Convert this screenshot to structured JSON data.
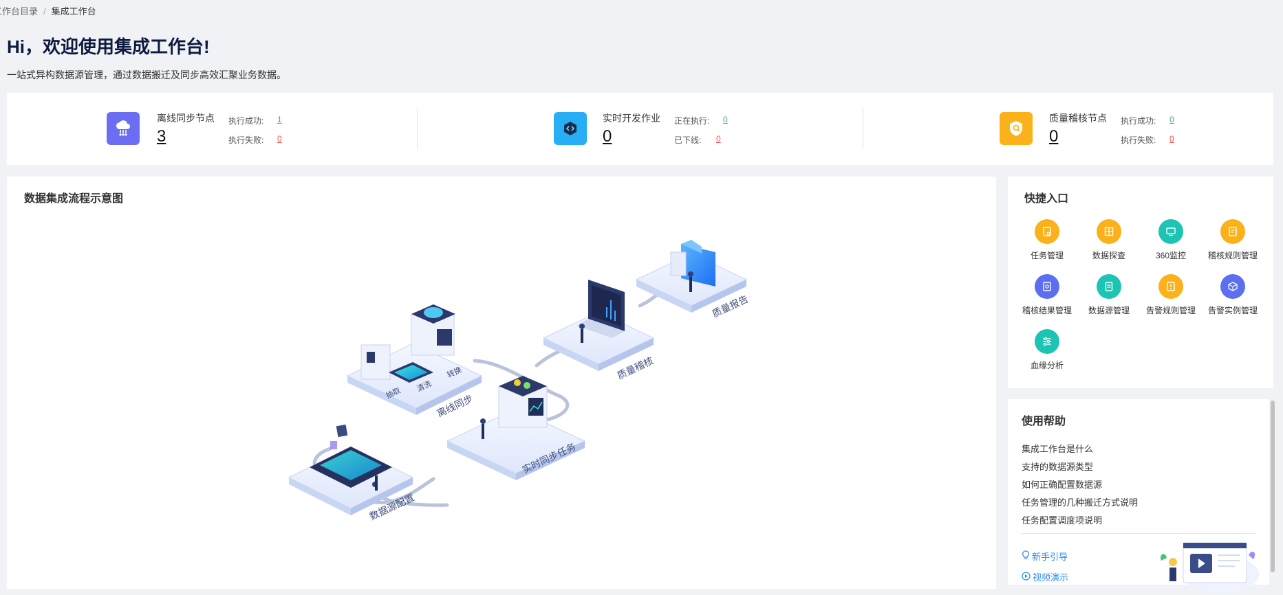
{
  "breadcrumb": {
    "parent": "工作台目录",
    "separator": "/",
    "current": "集成工作台"
  },
  "header": {
    "title": "Hi，欢迎使用集成工作台!",
    "subtitle": "一站式异构数据源管理，通过数据搬迁及同步高效汇聚业务数据。"
  },
  "stats": [
    {
      "name": "离线同步节点",
      "count": "3",
      "icon": "cloud-sync-icon",
      "color": "#6b6df2",
      "rows": [
        {
          "label": "执行成功:",
          "value": "1",
          "status": "success"
        },
        {
          "label": "执行失败:",
          "value": "0",
          "status": "error"
        }
      ]
    },
    {
      "name": "实时开发作业",
      "count": "0",
      "icon": "cube-code-icon",
      "color": "#27aef4",
      "rows": [
        {
          "label": "正在执行:",
          "value": "0",
          "status": "success"
        },
        {
          "label": "已下线:",
          "value": "0",
          "status": "error"
        }
      ]
    },
    {
      "name": "质量稽核节点",
      "count": "0",
      "icon": "shield-search-icon",
      "color": "#fbb11a",
      "rows": [
        {
          "label": "执行成功:",
          "value": "0",
          "status": "success"
        },
        {
          "label": "执行失败:",
          "value": "0",
          "status": "error"
        }
      ]
    }
  ],
  "diagram": {
    "title": "数据集成流程示意图",
    "stages": [
      "数据源配置",
      "离线同步",
      "实时同步任务",
      "质量稽核",
      "质量报告"
    ],
    "sub_labels": [
      "抽取",
      "清洗",
      "转换"
    ]
  },
  "quick_entry": {
    "title": "快捷入口",
    "items": [
      {
        "label": "任务管理",
        "icon": "task-doc-icon",
        "color": "#fbb11a"
      },
      {
        "label": "数据探查",
        "icon": "data-explore-icon",
        "color": "#fbb11a"
      },
      {
        "label": "360监控",
        "icon": "monitor-icon",
        "color": "#1cc4b4"
      },
      {
        "label": "稽核规则管理",
        "icon": "rule-doc-icon",
        "color": "#fbb11a"
      },
      {
        "label": "稽核结果管理",
        "icon": "result-doc-icon",
        "color": "#5b6ff0"
      },
      {
        "label": "数据源管理",
        "icon": "datasource-icon",
        "color": "#1cc4b4"
      },
      {
        "label": "告警规则管理",
        "icon": "alarm-rule-icon",
        "color": "#fbb11a"
      },
      {
        "label": "告警实例管理",
        "icon": "alarm-instance-icon",
        "color": "#5b6ff0"
      },
      {
        "label": "血缘分析",
        "icon": "lineage-sliders-icon",
        "color": "#1cc4b4"
      }
    ]
  },
  "help": {
    "title": "使用帮助",
    "links": [
      "集成工作台是什么",
      "支持的数据源类型",
      "如何正确配置数据源",
      "任务管理的几种搬迁方式说明",
      "任务配置调度项说明"
    ],
    "guide": "新手引导",
    "video": "视频演示"
  }
}
